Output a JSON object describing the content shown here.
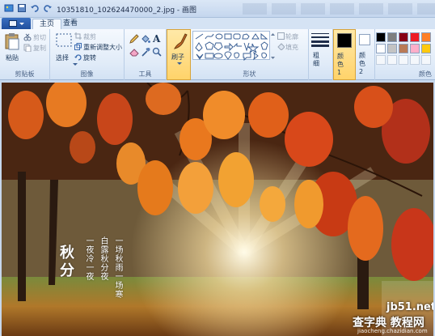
{
  "window": {
    "title": "10351810_102624470000_2.jpg - 画图"
  },
  "tabs": [
    {
      "label": "主页",
      "active": true
    },
    {
      "label": "查看",
      "active": false
    }
  ],
  "ribbon": {
    "clipboard": {
      "paste": "粘贴",
      "cut": "剪切",
      "copy": "复制",
      "caption": "剪贴板"
    },
    "image": {
      "select": "选择",
      "crop": "裁剪",
      "resize": "重新调整大小",
      "rotate": "旋转",
      "caption": "图像"
    },
    "tools": {
      "caption": "工具"
    },
    "brushes": {
      "label": "刷子"
    },
    "shapes": {
      "outline": "轮廓",
      "fill": "填充",
      "caption": "形状"
    },
    "size": {
      "label": "粗细"
    },
    "color1": {
      "label": "颜色 1"
    },
    "color2": {
      "label": "颜色 2"
    },
    "colors": {
      "caption": "颜色"
    }
  },
  "palette_colors": [
    "#000000",
    "#7f7f7f",
    "#880015",
    "#ed1c24",
    "#ff7f27",
    "#ffffff",
    "#c3c3c3",
    "#b97a57",
    "#ffaec9",
    "#ffc90e"
  ],
  "color1_value": "#000000",
  "color2_value": "#ffffff",
  "photo": {
    "poem_title": "秋分",
    "poem_lines": [
      "一场秋雨一场寒",
      "白露秋分夜",
      "一夜冷一夜"
    ]
  },
  "watermark": {
    "site": "jb51.net",
    "brand": "查字典 教程网",
    "url": "jiaocheng.chazidian.com"
  }
}
